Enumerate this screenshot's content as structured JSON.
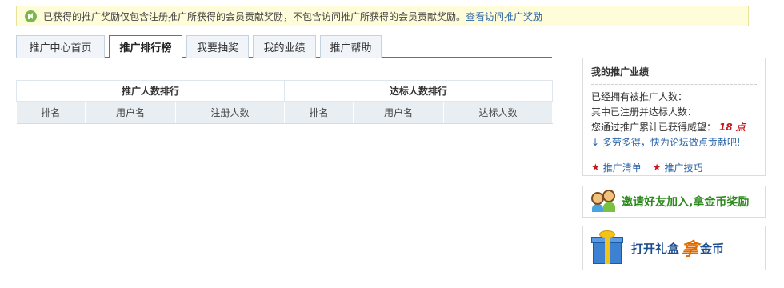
{
  "notice": {
    "text": "已获得的推广奖励仅包含注册推广所获得的会员贡献奖励，不包含访问推广所获得的会员贡献奖励。",
    "link": "查看访问推广奖励"
  },
  "tabs": [
    "推广中心首页",
    "推广排行榜",
    "我要抽奖",
    "我的业绩",
    "推广帮助"
  ],
  "active_tab": "推广排行榜",
  "ranking": {
    "left_title": "推广人数排行",
    "right_title": "达标人数排行",
    "left_columns": [
      "排名",
      "用户名",
      "注册人数"
    ],
    "right_columns": [
      "排名",
      "用户名",
      "达标人数"
    ]
  },
  "sidebar": {
    "title": "我的推广业绩",
    "referred_label": "已经拥有被推广人数：",
    "qualified_label": "其中已注册并达标人数：",
    "prestige_label": "您通过推广累计已获得威望：",
    "prestige_value": "18 点",
    "help_text": "↓ 多劳多得，快为论坛做点贡献吧!",
    "links": [
      "推广清单",
      "推广技巧"
    ]
  },
  "banners": {
    "invite": "邀请好友加入,拿金币奖励",
    "gift_left": "打开礼盒",
    "gift_accent": "拿",
    "gift_right": "金币"
  },
  "colors": {
    "notice_bg": "#fefcd9",
    "tab_border": "#3f7cb6",
    "link": "#2a64a8",
    "accent_red": "#c8161d",
    "invite_green": "#2f8a1f"
  }
}
